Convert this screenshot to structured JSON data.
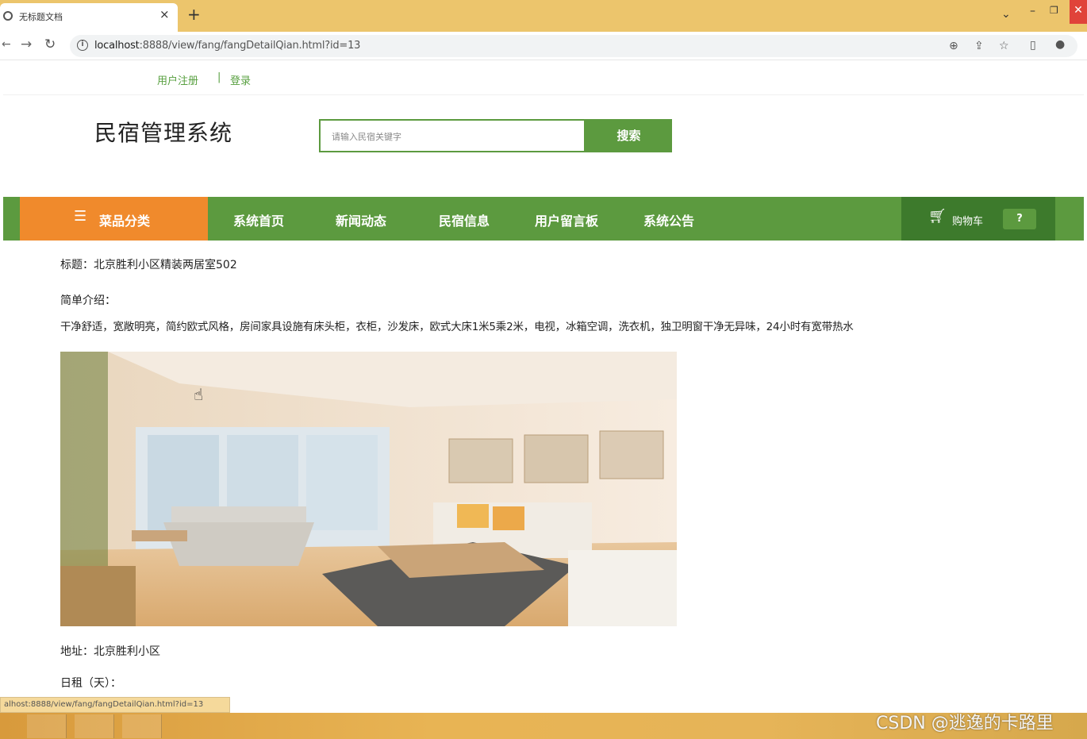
{
  "browser": {
    "tab_title": "无标题文档",
    "tab_close": "×",
    "new_tab": "+",
    "url_host": "localhost",
    "url_rest": ":8888/view/fang/fangDetailQian.html?id=13",
    "status_url": "alhost:8888/view/fang/fangDetailQian.html?id=13"
  },
  "header": {
    "register": "用户注册",
    "separator": "|",
    "login": "登录",
    "site_title": "民宿管理系统",
    "search_placeholder": "请输入民宿关键字",
    "search_button": "搜索"
  },
  "nav": {
    "category": "菜品分类",
    "items": [
      "系统首页",
      "新闻动态",
      "民宿信息",
      "用户留言板",
      "系统公告"
    ],
    "cart": "购物车",
    "cart_badge": "?"
  },
  "detail": {
    "title": "标题：北京胜利小区精装两居室502",
    "intro_label": "简单介绍：",
    "intro_text": "干净舒适，宽敞明亮，简约欧式风格，房间家具设施有床头柜，衣柜，沙发床，欧式大床1米5乘2米，电视，冰箱空调，洗衣机，独卫明窗干净无异味，24小时有宽带热水",
    "address": "地址：北京胜利小区",
    "daily_rent": "日租（天）："
  },
  "watermark": "CSDN @逃逸的卡路里",
  "colors": {
    "brand_green": "#5c9a3f",
    "accent_orange": "#f08a2c",
    "tab_bar": "#ecc56c"
  }
}
